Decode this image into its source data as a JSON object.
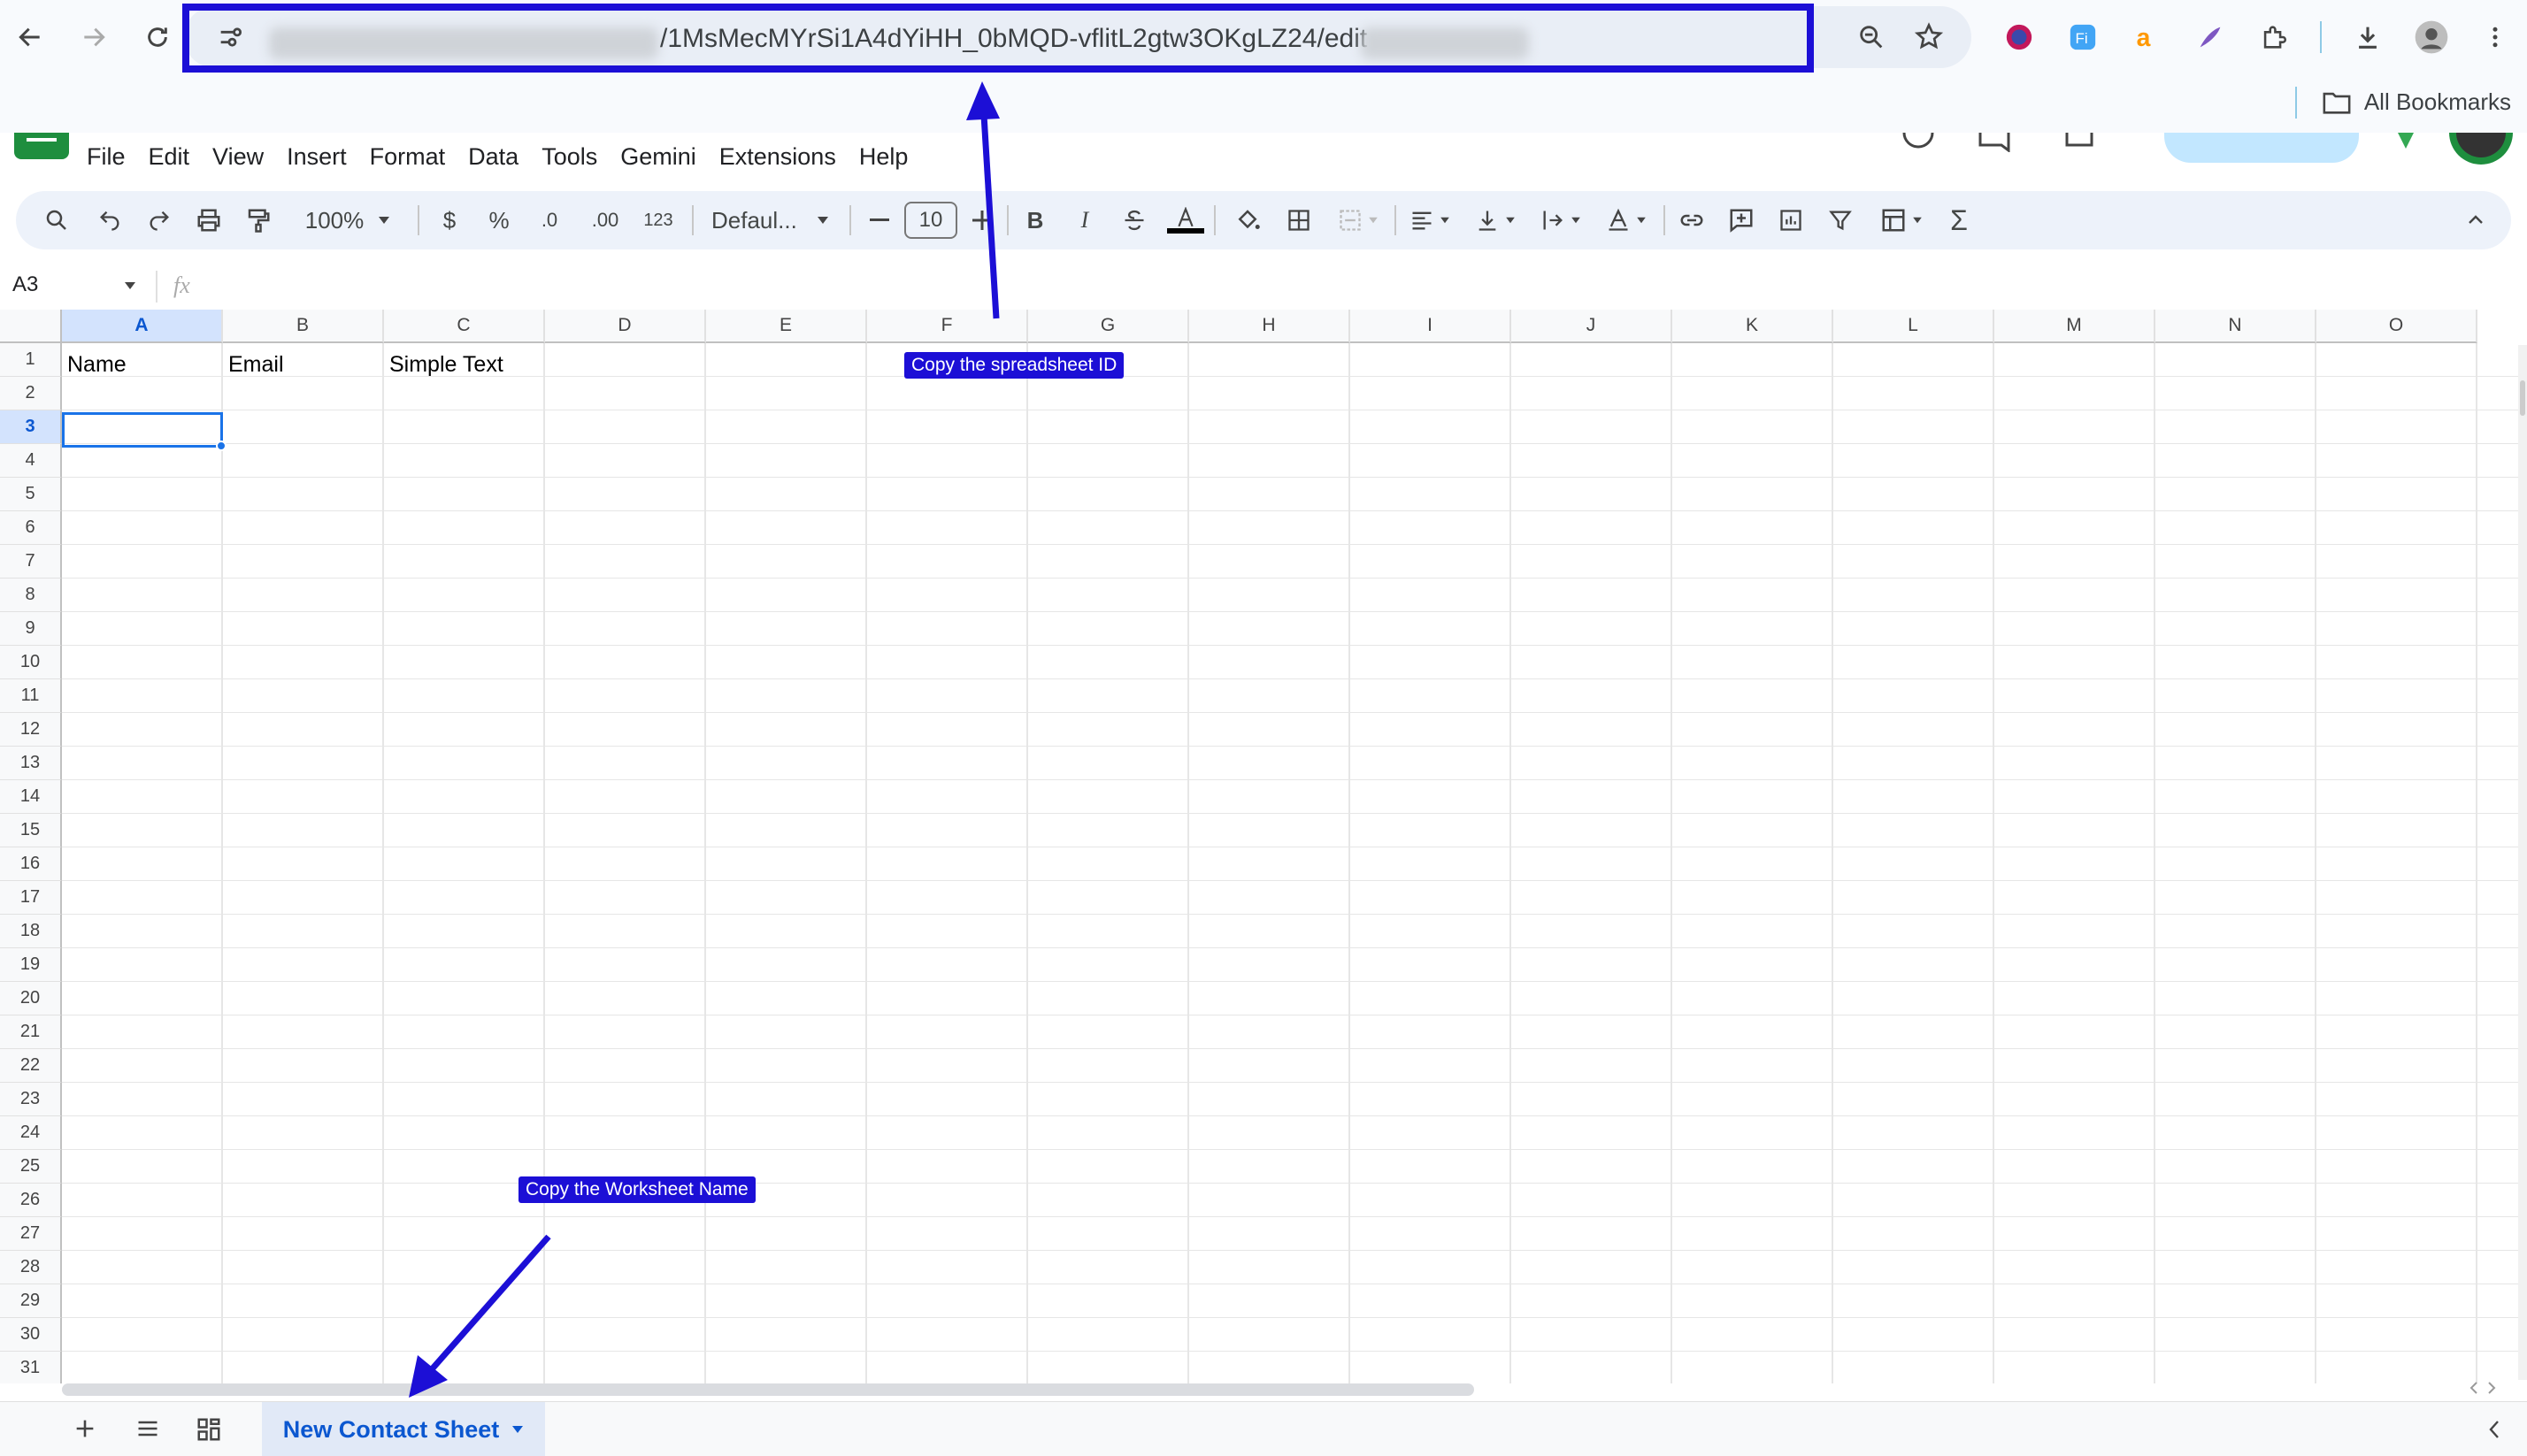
{
  "browser": {
    "url_visible": "/1MsMecMYrSi1A4dYiHH_0bMQD-vflitL2gtw3OKgLZ24/edit",
    "bookmarks_label": "All Bookmarks"
  },
  "menu": [
    "File",
    "Edit",
    "View",
    "Insert",
    "Format",
    "Data",
    "Tools",
    "Gemini",
    "Extensions",
    "Help"
  ],
  "toolbar": {
    "zoom": "100%",
    "currency": "$",
    "percent": "%",
    "dec_decrease": ".0",
    "dec_increase": ".00",
    "more_formats": "123",
    "font": "Defaul...",
    "font_size": "10",
    "bold": "B",
    "italic": "I",
    "sum": "Σ"
  },
  "formula_bar": {
    "name_box": "A3",
    "fx": "fx"
  },
  "columns": [
    "A",
    "B",
    "C",
    "D",
    "E",
    "F",
    "G",
    "H",
    "I",
    "J",
    "K",
    "L",
    "M",
    "N",
    "O"
  ],
  "rows": [
    "1",
    "2",
    "3",
    "4",
    "5",
    "6",
    "7",
    "8",
    "9",
    "10",
    "11",
    "12",
    "13",
    "14",
    "15",
    "16",
    "17",
    "18",
    "19",
    "20",
    "21",
    "22",
    "23",
    "24",
    "25",
    "26",
    "27",
    "28",
    "29",
    "30",
    "31"
  ],
  "cells": {
    "A1": "Name",
    "B1": "Email",
    "C1": "Simple Text"
  },
  "selected_cell": "A3",
  "annotations": {
    "spreadsheet_id": "Copy the spreadsheet ID",
    "worksheet_name": "Copy the Worksheet Name"
  },
  "sheet_tab": {
    "name": "New Contact Sheet"
  },
  "colors": {
    "annotation": "#1c0fd6",
    "selection": "#1a73e8",
    "header_selected": "#d3e3fd"
  }
}
